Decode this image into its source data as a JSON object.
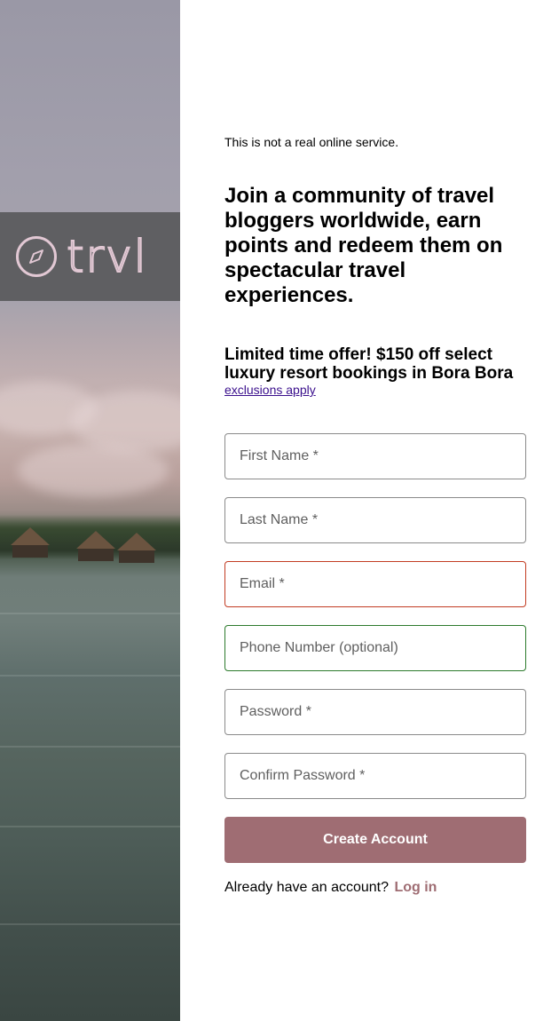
{
  "brand": {
    "name": "trvl",
    "logo_icon": "compass-icon"
  },
  "disclaimer": "This is not a real online service.",
  "headline": "Join a community of travel bloggers worldwide, earn points and redeem them on spectacular travel experiences.",
  "offer": {
    "text": "Limited time offer! $150 off select luxury resort bookings in Bora Bora",
    "link": "exclusions apply"
  },
  "form": {
    "first_name": {
      "placeholder": "First Name *",
      "value": ""
    },
    "last_name": {
      "placeholder": "Last Name *",
      "value": ""
    },
    "email": {
      "placeholder": "Email *",
      "value": "",
      "state": "error"
    },
    "phone": {
      "placeholder": "Phone Number (optional)",
      "value": "",
      "state": "valid"
    },
    "password": {
      "placeholder": "Password *",
      "value": ""
    },
    "confirm_password": {
      "placeholder": "Confirm Password *",
      "value": ""
    },
    "submit_label": "Create Account"
  },
  "login": {
    "prompt": "Already have an account?",
    "link": "Log in"
  },
  "colors": {
    "accent": "#9f6d73",
    "error": "#c23c22",
    "valid": "#2c7a2c",
    "logo": "#e2c8d4"
  }
}
